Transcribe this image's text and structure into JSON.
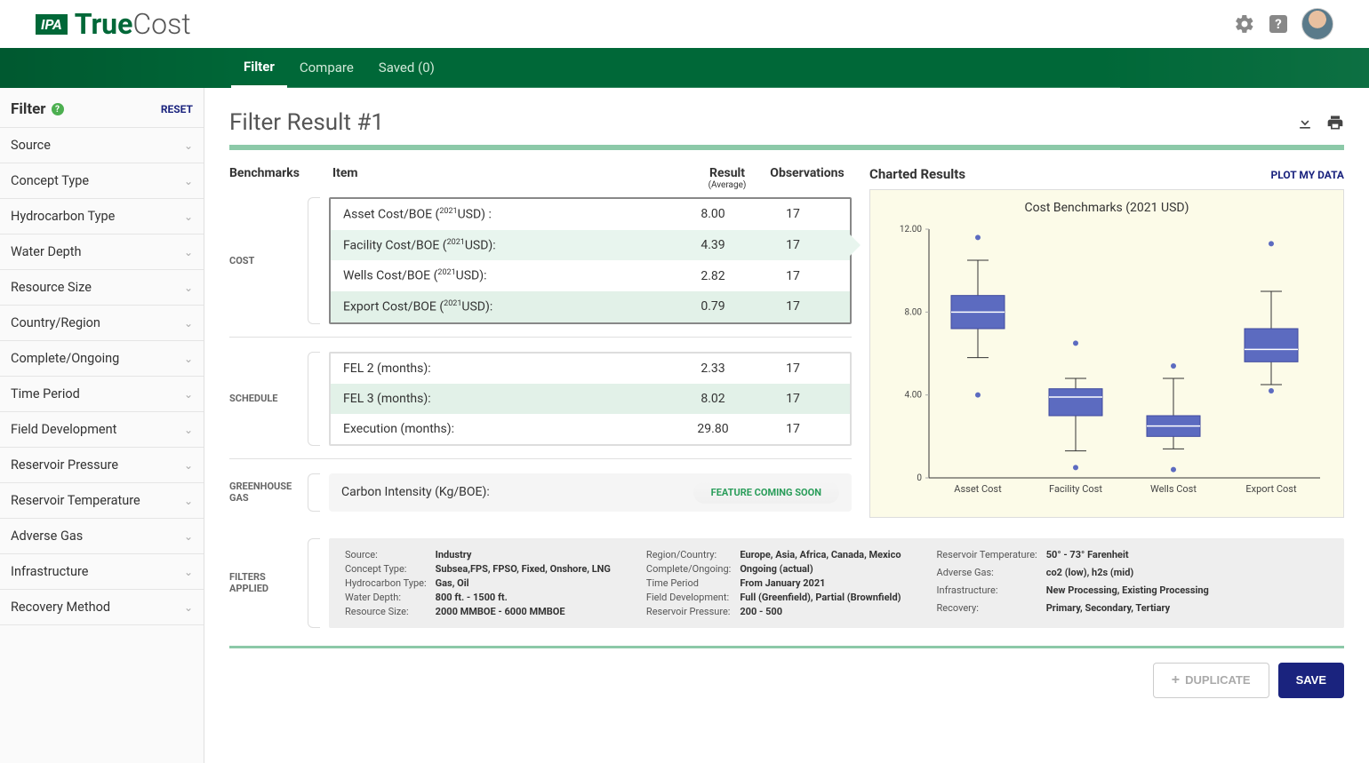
{
  "header": {
    "brand_prefix": "IPA",
    "brand_bold": "True",
    "brand_light": "Cost"
  },
  "nav": {
    "tabs": [
      "Filter",
      "Compare",
      "Saved (0)"
    ],
    "active": 0
  },
  "sidebar": {
    "title": "Filter",
    "reset": "RESET",
    "items": [
      "Source",
      "Concept Type",
      "Hydrocarbon Type",
      "Water Depth",
      "Resource Size",
      "Country/Region",
      "Complete/Ongoing",
      "Time Period",
      "Field Development",
      "Reservoir Pressure",
      "Reservoir Temperature",
      "Adverse Gas",
      "Infrastructure",
      "Recovery Method"
    ]
  },
  "page": {
    "title": "Filter Result #1"
  },
  "benchmarks": {
    "label": "Benchmarks",
    "cols": {
      "item": "Item",
      "result": "Result",
      "result_sub": "(Average)",
      "obs": "Observations"
    },
    "cost": {
      "label": "COST",
      "rows": [
        {
          "item_prefix": "Asset Cost/BOE (",
          "sup": "2021",
          "item_suffix": "USD) :",
          "result": "8.00",
          "obs": "17"
        },
        {
          "item_prefix": "Facility Cost/BOE (",
          "sup": "2021",
          "item_suffix": "USD):",
          "result": "4.39",
          "obs": "17"
        },
        {
          "item_prefix": "Wells Cost/BOE (",
          "sup": "2021",
          "item_suffix": "USD):",
          "result": "2.82",
          "obs": "17"
        },
        {
          "item_prefix": "Export Cost/BOE (",
          "sup": "2021",
          "item_suffix": "USD):",
          "result": "0.79",
          "obs": "17"
        }
      ]
    },
    "schedule": {
      "label": "SCHEDULE",
      "rows": [
        {
          "item": "FEL 2 (months):",
          "result": "2.33",
          "obs": "17"
        },
        {
          "item": "FEL 3 (months):",
          "result": "8.02",
          "obs": "17"
        },
        {
          "item": "Execution (months):",
          "result": "29.80",
          "obs": "17"
        }
      ]
    },
    "ghg": {
      "label": "GREENHOUSE GAS",
      "item": "Carbon Intensity (Kg/BOE):",
      "pill": "FEATURE COMING SOON"
    }
  },
  "chart": {
    "heading": "Charted Results",
    "plot_link": "PLOT MY DATA",
    "title": "Cost Benchmarks (2021 USD)"
  },
  "chart_data": {
    "type": "boxplot",
    "title": "Cost Benchmarks (2021 USD)",
    "xlabel": "",
    "ylabel": "",
    "ylim": [
      0,
      12
    ],
    "yticks": [
      0,
      4.0,
      8.0,
      12.0
    ],
    "ytick_labels": [
      "0",
      "4.00",
      "8.00",
      "12.00"
    ],
    "categories": [
      "Asset Cost",
      "Facility Cost",
      "Wells Cost",
      "Export Cost"
    ],
    "series": [
      {
        "name": "Asset Cost",
        "low": 5.8,
        "q1": 7.2,
        "median": 8.0,
        "q3": 8.8,
        "high": 10.5,
        "outliers": [
          11.6,
          4.0
        ]
      },
      {
        "name": "Facility Cost",
        "low": 1.3,
        "q1": 3.0,
        "median": 3.9,
        "q3": 4.3,
        "high": 4.8,
        "outliers": [
          6.5,
          0.5
        ]
      },
      {
        "name": "Wells Cost",
        "low": 1.4,
        "q1": 2.0,
        "median": 2.5,
        "q3": 3.0,
        "high": 4.8,
        "outliers": [
          5.4,
          0.4
        ]
      },
      {
        "name": "Export Cost",
        "low": 4.5,
        "q1": 5.6,
        "median": 6.2,
        "q3": 7.2,
        "high": 9.0,
        "outliers": [
          11.3,
          4.2
        ]
      }
    ]
  },
  "filters_applied": {
    "label": "FILTERS APPLIED",
    "cols": [
      [
        {
          "l": "Source:",
          "v": "Industry"
        },
        {
          "l": "Concept Type:",
          "v": "Subsea,FPS, FPSO, Fixed, Onshore, LNG"
        },
        {
          "l": "Hydrocarbon Type:",
          "v": "Gas, Oil"
        },
        {
          "l": "Water Depth:",
          "v": "800 ft. - 1500 ft."
        },
        {
          "l": "Resource Size:",
          "v": "2000 MMBOE - 6000 MMBOE"
        }
      ],
      [
        {
          "l": "Region/Country:",
          "v": "Europe, Asia, Africa, Canada, Mexico"
        },
        {
          "l": "Complete/Ongoing:",
          "v": "Ongoing (actual)"
        },
        {
          "l": "Time Period",
          "v": "From January 2021"
        },
        {
          "l": "Field Development:",
          "v": "Full (Greenfield), Partial (Brownfield)"
        },
        {
          "l": "Reservoir Pressure:",
          "v": "200 - 500"
        }
      ],
      [
        {
          "l": "Reservoir Temperature:",
          "v": "50° - 73° Farenheit"
        },
        {
          "l": "Adverse Gas:",
          "v": "co2 (low), h2s (mid)"
        },
        {
          "l": "Infrastructure:",
          "v": "New Processing, Existing Processing"
        },
        {
          "l": "Recovery:",
          "v": "Primary, Secondary, Tertiary"
        }
      ]
    ]
  },
  "actions": {
    "duplicate": "DUPLICATE",
    "save": "SAVE"
  }
}
